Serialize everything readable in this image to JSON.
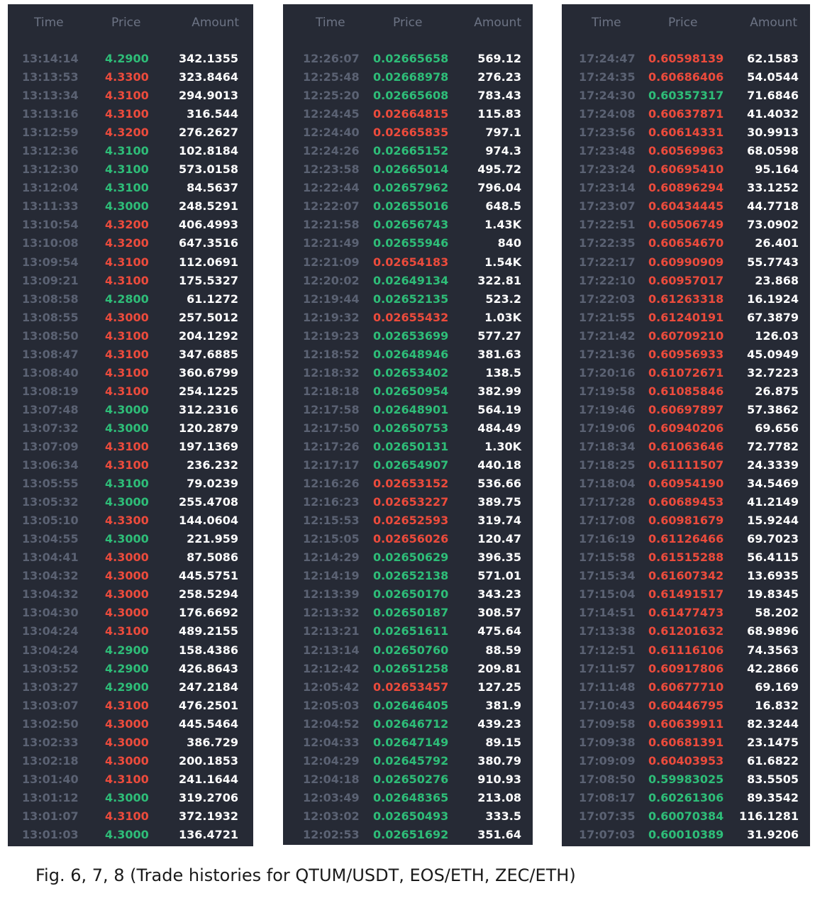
{
  "headers": {
    "time": "Time",
    "price": "Price",
    "amount": "Amount"
  },
  "caption": "Fig. 6, 7, 8 (Trade histories for QTUM/USDT, EOS/ETH, ZEC/ETH)",
  "colors": {
    "up": "#2ebd78",
    "down": "#ec4b3c",
    "panel_bg": "#262a35",
    "time_text": "#5b6273",
    "header_text": "#6c7384"
  },
  "panels": [
    {
      "rows": [
        [
          "13:14:14",
          "4.2900",
          "342.1355",
          "up"
        ],
        [
          "13:13:53",
          "4.3300",
          "323.8464",
          "down"
        ],
        [
          "13:13:34",
          "4.3100",
          "294.9013",
          "down"
        ],
        [
          "13:13:16",
          "4.3100",
          "316.544",
          "down"
        ],
        [
          "13:12:59",
          "4.3200",
          "276.2627",
          "down"
        ],
        [
          "13:12:36",
          "4.3100",
          "102.8184",
          "up"
        ],
        [
          "13:12:30",
          "4.3100",
          "573.0158",
          "up"
        ],
        [
          "13:12:04",
          "4.3100",
          "84.5637",
          "up"
        ],
        [
          "13:11:33",
          "4.3000",
          "248.5291",
          "up"
        ],
        [
          "13:10:54",
          "4.3200",
          "406.4993",
          "down"
        ],
        [
          "13:10:08",
          "4.3200",
          "647.3516",
          "down"
        ],
        [
          "13:09:54",
          "4.3100",
          "112.0691",
          "down"
        ],
        [
          "13:09:21",
          "4.3100",
          "175.5327",
          "down"
        ],
        [
          "13:08:58",
          "4.2800",
          "61.1272",
          "up"
        ],
        [
          "13:08:55",
          "4.3000",
          "257.5012",
          "down"
        ],
        [
          "13:08:50",
          "4.3100",
          "204.1292",
          "down"
        ],
        [
          "13:08:47",
          "4.3100",
          "347.6885",
          "down"
        ],
        [
          "13:08:40",
          "4.3100",
          "360.6799",
          "down"
        ],
        [
          "13:08:19",
          "4.3100",
          "254.1225",
          "down"
        ],
        [
          "13:07:48",
          "4.3000",
          "312.2316",
          "up"
        ],
        [
          "13:07:32",
          "4.3000",
          "120.2879",
          "up"
        ],
        [
          "13:07:09",
          "4.3100",
          "197.1369",
          "down"
        ],
        [
          "13:06:34",
          "4.3100",
          "236.232",
          "down"
        ],
        [
          "13:05:55",
          "4.3100",
          "79.0239",
          "up"
        ],
        [
          "13:05:32",
          "4.3000",
          "255.4708",
          "up"
        ],
        [
          "13:05:10",
          "4.3300",
          "144.0604",
          "down"
        ],
        [
          "13:04:55",
          "4.3000",
          "221.959",
          "up"
        ],
        [
          "13:04:41",
          "4.3000",
          "87.5086",
          "down"
        ],
        [
          "13:04:32",
          "4.3000",
          "445.5751",
          "down"
        ],
        [
          "13:04:32",
          "4.3000",
          "258.5294",
          "down"
        ],
        [
          "13:04:30",
          "4.3000",
          "176.6692",
          "down"
        ],
        [
          "13:04:24",
          "4.3100",
          "489.2155",
          "down"
        ],
        [
          "13:04:24",
          "4.2900",
          "158.4386",
          "up"
        ],
        [
          "13:03:52",
          "4.2900",
          "426.8643",
          "up"
        ],
        [
          "13:03:27",
          "4.2900",
          "247.2184",
          "up"
        ],
        [
          "13:03:07",
          "4.3100",
          "476.2501",
          "down"
        ],
        [
          "13:02:50",
          "4.3000",
          "445.5464",
          "down"
        ],
        [
          "13:02:33",
          "4.3000",
          "386.729",
          "down"
        ],
        [
          "13:02:18",
          "4.3000",
          "200.1853",
          "down"
        ],
        [
          "13:01:40",
          "4.3100",
          "241.1644",
          "down"
        ],
        [
          "13:01:12",
          "4.3000",
          "319.2706",
          "up"
        ],
        [
          "13:01:07",
          "4.3100",
          "372.1932",
          "down"
        ],
        [
          "13:01:03",
          "4.3000",
          "136.4721",
          "up"
        ]
      ]
    },
    {
      "rows": [
        [
          "12:26:07",
          "0.02665658",
          "569.12",
          "up"
        ],
        [
          "12:25:48",
          "0.02668978",
          "276.23",
          "up"
        ],
        [
          "12:25:20",
          "0.02665608",
          "783.43",
          "up"
        ],
        [
          "12:24:45",
          "0.02664815",
          "115.83",
          "down"
        ],
        [
          "12:24:40",
          "0.02665835",
          "797.1",
          "down"
        ],
        [
          "12:24:26",
          "0.02665152",
          "974.3",
          "up"
        ],
        [
          "12:23:58",
          "0.02665014",
          "495.72",
          "up"
        ],
        [
          "12:22:44",
          "0.02657962",
          "796.04",
          "up"
        ],
        [
          "12:22:07",
          "0.02655016",
          "648.5",
          "up"
        ],
        [
          "12:21:58",
          "0.02656743",
          "1.43K",
          "up"
        ],
        [
          "12:21:49",
          "0.02655946",
          "840",
          "up"
        ],
        [
          "12:21:09",
          "0.02654183",
          "1.54K",
          "down"
        ],
        [
          "12:20:02",
          "0.02649134",
          "322.81",
          "up"
        ],
        [
          "12:19:44",
          "0.02652135",
          "523.2",
          "up"
        ],
        [
          "12:19:32",
          "0.02655432",
          "1.03K",
          "down"
        ],
        [
          "12:19:23",
          "0.02653699",
          "577.27",
          "up"
        ],
        [
          "12:18:52",
          "0.02648946",
          "381.63",
          "up"
        ],
        [
          "12:18:32",
          "0.02653402",
          "138.5",
          "up"
        ],
        [
          "12:18:18",
          "0.02650954",
          "382.99",
          "up"
        ],
        [
          "12:17:58",
          "0.02648901",
          "564.19",
          "up"
        ],
        [
          "12:17:50",
          "0.02650753",
          "484.49",
          "up"
        ],
        [
          "12:17:26",
          "0.02650131",
          "1.30K",
          "up"
        ],
        [
          "12:17:17",
          "0.02654907",
          "440.18",
          "up"
        ],
        [
          "12:16:26",
          "0.02653152",
          "536.66",
          "down"
        ],
        [
          "12:16:23",
          "0.02653227",
          "389.75",
          "down"
        ],
        [
          "12:15:53",
          "0.02652593",
          "319.74",
          "down"
        ],
        [
          "12:15:05",
          "0.02656026",
          "120.47",
          "down"
        ],
        [
          "12:14:29",
          "0.02650629",
          "396.35",
          "up"
        ],
        [
          "12:14:19",
          "0.02652138",
          "571.01",
          "up"
        ],
        [
          "12:13:39",
          "0.02650170",
          "343.23",
          "up"
        ],
        [
          "12:13:32",
          "0.02650187",
          "308.57",
          "up"
        ],
        [
          "12:13:21",
          "0.02651611",
          "475.64",
          "up"
        ],
        [
          "12:13:14",
          "0.02650760",
          "88.59",
          "up"
        ],
        [
          "12:12:42",
          "0.02651258",
          "209.81",
          "up"
        ],
        [
          "12:05:42",
          "0.02653457",
          "127.25",
          "down"
        ],
        [
          "12:05:03",
          "0.02646405",
          "381.9",
          "up"
        ],
        [
          "12:04:52",
          "0.02646712",
          "439.23",
          "up"
        ],
        [
          "12:04:33",
          "0.02647149",
          "89.15",
          "up"
        ],
        [
          "12:04:29",
          "0.02645792",
          "380.79",
          "up"
        ],
        [
          "12:04:18",
          "0.02650276",
          "910.93",
          "up"
        ],
        [
          "12:03:49",
          "0.02648365",
          "213.08",
          "up"
        ],
        [
          "12:03:02",
          "0.02650493",
          "333.5",
          "up"
        ],
        [
          "12:02:53",
          "0.02651692",
          "351.64",
          "up"
        ]
      ]
    },
    {
      "rows": [
        [
          "17:24:47",
          "0.60598139",
          "62.1583",
          "down"
        ],
        [
          "17:24:35",
          "0.60686406",
          "54.0544",
          "down"
        ],
        [
          "17:24:30",
          "0.60357317",
          "71.6846",
          "up"
        ],
        [
          "17:24:08",
          "0.60637871",
          "41.4032",
          "down"
        ],
        [
          "17:23:56",
          "0.60614331",
          "30.9913",
          "down"
        ],
        [
          "17:23:48",
          "0.60569963",
          "68.0598",
          "down"
        ],
        [
          "17:23:24",
          "0.60695410",
          "95.164",
          "down"
        ],
        [
          "17:23:14",
          "0.60896294",
          "33.1252",
          "down"
        ],
        [
          "17:23:07",
          "0.60434445",
          "44.7718",
          "down"
        ],
        [
          "17:22:51",
          "0.60506749",
          "73.0902",
          "down"
        ],
        [
          "17:22:35",
          "0.60654670",
          "26.401",
          "down"
        ],
        [
          "17:22:17",
          "0.60990909",
          "55.7743",
          "down"
        ],
        [
          "17:22:10",
          "0.60957017",
          "23.868",
          "down"
        ],
        [
          "17:22:03",
          "0.61263318",
          "16.1924",
          "down"
        ],
        [
          "17:21:55",
          "0.61240191",
          "67.3879",
          "down"
        ],
        [
          "17:21:42",
          "0.60709210",
          "126.03",
          "down"
        ],
        [
          "17:21:36",
          "0.60956933",
          "45.0949",
          "down"
        ],
        [
          "17:20:16",
          "0.61072671",
          "32.7223",
          "down"
        ],
        [
          "17:19:58",
          "0.61085846",
          "26.875",
          "down"
        ],
        [
          "17:19:46",
          "0.60697897",
          "57.3862",
          "down"
        ],
        [
          "17:19:06",
          "0.60940206",
          "69.656",
          "down"
        ],
        [
          "17:18:34",
          "0.61063646",
          "72.7782",
          "down"
        ],
        [
          "17:18:25",
          "0.61111507",
          "24.3339",
          "down"
        ],
        [
          "17:18:04",
          "0.60954190",
          "34.5469",
          "down"
        ],
        [
          "17:17:28",
          "0.60689453",
          "41.2149",
          "down"
        ],
        [
          "17:17:08",
          "0.60981679",
          "15.9244",
          "down"
        ],
        [
          "17:16:19",
          "0.61126466",
          "69.7023",
          "down"
        ],
        [
          "17:15:58",
          "0.61515288",
          "56.4115",
          "down"
        ],
        [
          "17:15:34",
          "0.61607342",
          "13.6935",
          "down"
        ],
        [
          "17:15:04",
          "0.61491517",
          "19.8345",
          "down"
        ],
        [
          "17:14:51",
          "0.61477473",
          "58.202",
          "down"
        ],
        [
          "17:13:38",
          "0.61201632",
          "68.9896",
          "down"
        ],
        [
          "17:12:51",
          "0.61116106",
          "74.3563",
          "down"
        ],
        [
          "17:11:57",
          "0.60917806",
          "42.2866",
          "down"
        ],
        [
          "17:11:48",
          "0.60677710",
          "69.169",
          "down"
        ],
        [
          "17:10:43",
          "0.60446795",
          "16.832",
          "down"
        ],
        [
          "17:09:58",
          "0.60639911",
          "82.3244",
          "down"
        ],
        [
          "17:09:38",
          "0.60681391",
          "23.1475",
          "down"
        ],
        [
          "17:09:09",
          "0.60403953",
          "61.6822",
          "down"
        ],
        [
          "17:08:50",
          "0.59983025",
          "83.5505",
          "up"
        ],
        [
          "17:08:17",
          "0.60261306",
          "89.3542",
          "up"
        ],
        [
          "17:07:35",
          "0.60070384",
          "116.1281",
          "up"
        ],
        [
          "17:07:03",
          "0.60010389",
          "31.9206",
          "up"
        ]
      ]
    }
  ]
}
